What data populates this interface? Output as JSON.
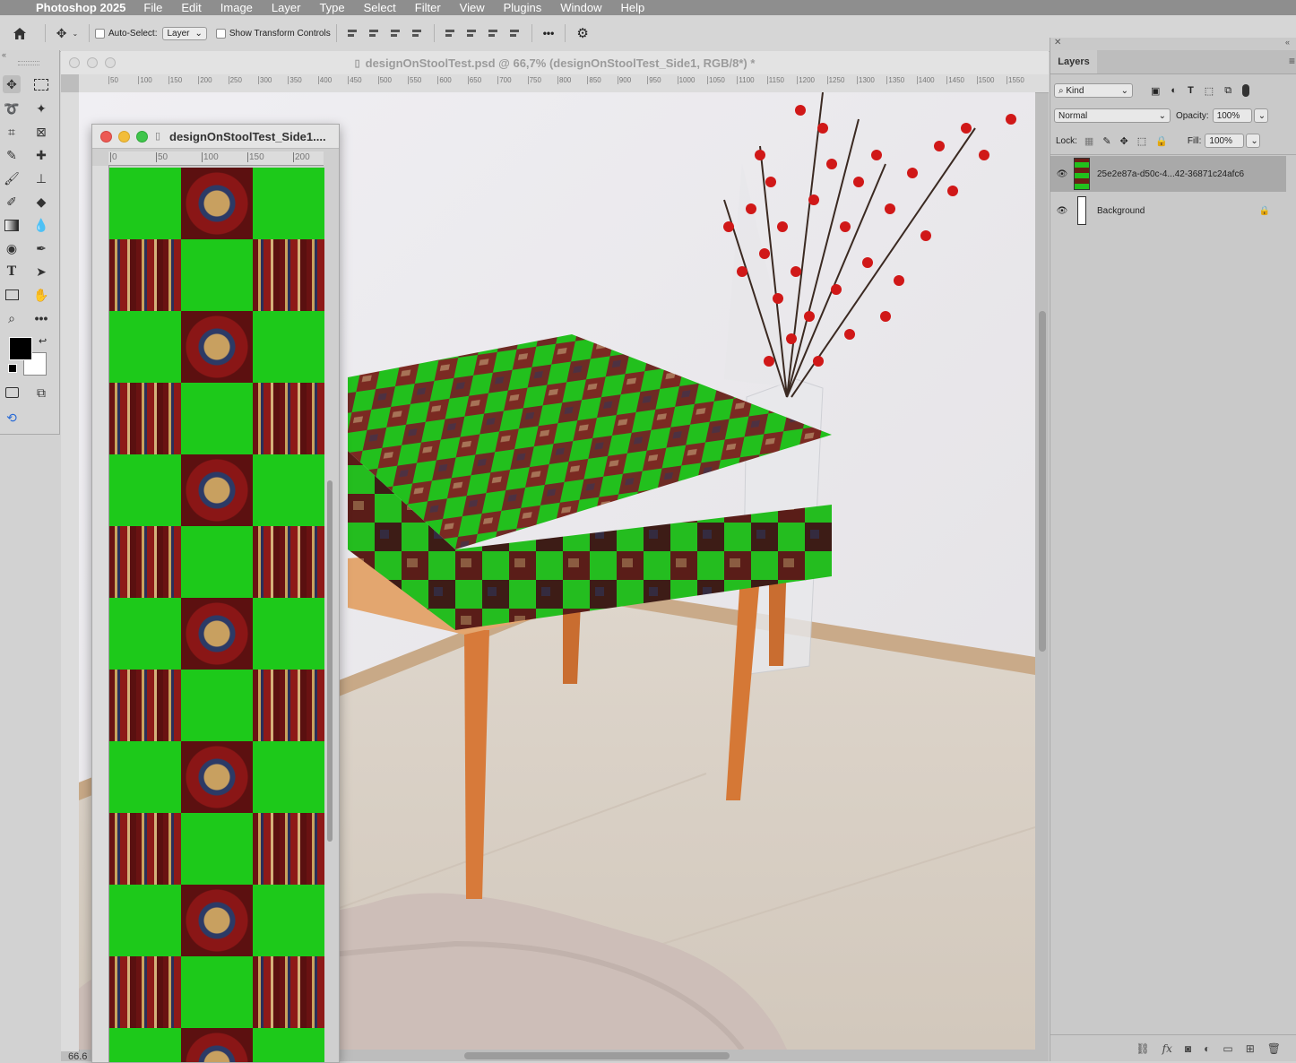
{
  "menubar": {
    "apple_icon": "apple-icon",
    "app_name": "Photoshop 2025",
    "items": [
      "File",
      "Edit",
      "Image",
      "Layer",
      "Type",
      "Select",
      "Filter",
      "View",
      "Plugins",
      "Window",
      "Help"
    ]
  },
  "options": {
    "auto_select_label": "Auto-Select:",
    "auto_select_value": "Layer",
    "show_transform_label": "Show Transform Controls",
    "more_label": "•••"
  },
  "document": {
    "title": "designOnStoolTest.psd @ 66,7% (designOnStoolTest_Side1, RGB/8*) *",
    "zoom": "66.6",
    "ruler_ticks": [
      "50",
      "100",
      "150",
      "200",
      "250",
      "300",
      "350",
      "400",
      "450",
      "500",
      "550",
      "600",
      "650",
      "700",
      "750",
      "800",
      "850",
      "900",
      "950",
      "1000",
      "1050",
      "1100",
      "1150",
      "1200",
      "1250",
      "1300",
      "1350",
      "1400",
      "1450",
      "1500",
      "1550"
    ]
  },
  "float_window": {
    "title": "designOnStoolTest_Side1....",
    "ruler_ticks": [
      "0",
      "50",
      "100",
      "150",
      "200"
    ]
  },
  "layers_panel": {
    "tab": "Layers",
    "filter_kind": "Kind",
    "blend_mode": "Normal",
    "opacity_label": "Opacity:",
    "opacity_value": "100%",
    "lock_label": "Lock:",
    "fill_label": "Fill:",
    "fill_value": "100%",
    "layers": [
      {
        "name": "25e2e87a-d50c-4...42-36871c24afc6",
        "selected": true
      },
      {
        "name": "Background",
        "selected": false,
        "locked": true
      }
    ]
  },
  "colors": {
    "checker_green": "#1dc91a",
    "carpet_red": "#7a1414",
    "menubar": "#8e8e8e"
  }
}
